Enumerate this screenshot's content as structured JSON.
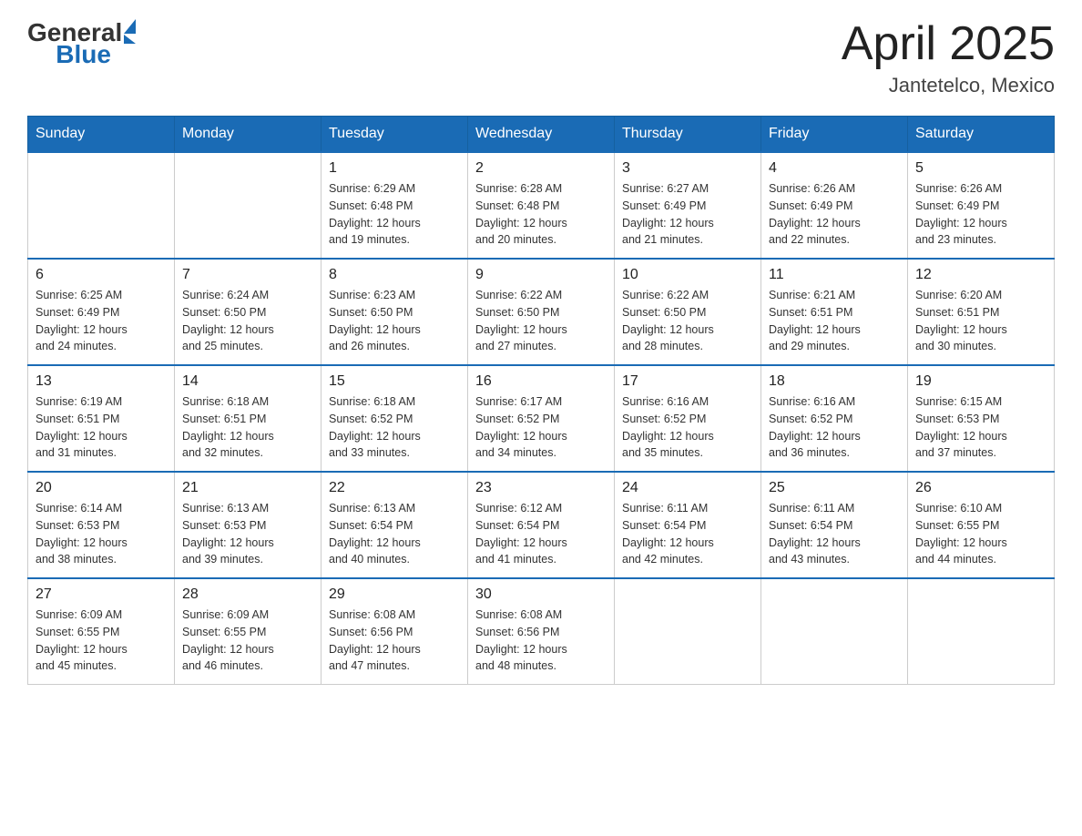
{
  "logo": {
    "general": "General",
    "blue": "Blue"
  },
  "title": {
    "month_year": "April 2025",
    "location": "Jantetelco, Mexico"
  },
  "header_days": [
    "Sunday",
    "Monday",
    "Tuesday",
    "Wednesday",
    "Thursday",
    "Friday",
    "Saturday"
  ],
  "weeks": [
    {
      "days": [
        {
          "num": "",
          "info": []
        },
        {
          "num": "",
          "info": []
        },
        {
          "num": "1",
          "info": [
            "Sunrise: 6:29 AM",
            "Sunset: 6:48 PM",
            "Daylight: 12 hours",
            "and 19 minutes."
          ]
        },
        {
          "num": "2",
          "info": [
            "Sunrise: 6:28 AM",
            "Sunset: 6:48 PM",
            "Daylight: 12 hours",
            "and 20 minutes."
          ]
        },
        {
          "num": "3",
          "info": [
            "Sunrise: 6:27 AM",
            "Sunset: 6:49 PM",
            "Daylight: 12 hours",
            "and 21 minutes."
          ]
        },
        {
          "num": "4",
          "info": [
            "Sunrise: 6:26 AM",
            "Sunset: 6:49 PM",
            "Daylight: 12 hours",
            "and 22 minutes."
          ]
        },
        {
          "num": "5",
          "info": [
            "Sunrise: 6:26 AM",
            "Sunset: 6:49 PM",
            "Daylight: 12 hours",
            "and 23 minutes."
          ]
        }
      ]
    },
    {
      "days": [
        {
          "num": "6",
          "info": [
            "Sunrise: 6:25 AM",
            "Sunset: 6:49 PM",
            "Daylight: 12 hours",
            "and 24 minutes."
          ]
        },
        {
          "num": "7",
          "info": [
            "Sunrise: 6:24 AM",
            "Sunset: 6:50 PM",
            "Daylight: 12 hours",
            "and 25 minutes."
          ]
        },
        {
          "num": "8",
          "info": [
            "Sunrise: 6:23 AM",
            "Sunset: 6:50 PM",
            "Daylight: 12 hours",
            "and 26 minutes."
          ]
        },
        {
          "num": "9",
          "info": [
            "Sunrise: 6:22 AM",
            "Sunset: 6:50 PM",
            "Daylight: 12 hours",
            "and 27 minutes."
          ]
        },
        {
          "num": "10",
          "info": [
            "Sunrise: 6:22 AM",
            "Sunset: 6:50 PM",
            "Daylight: 12 hours",
            "and 28 minutes."
          ]
        },
        {
          "num": "11",
          "info": [
            "Sunrise: 6:21 AM",
            "Sunset: 6:51 PM",
            "Daylight: 12 hours",
            "and 29 minutes."
          ]
        },
        {
          "num": "12",
          "info": [
            "Sunrise: 6:20 AM",
            "Sunset: 6:51 PM",
            "Daylight: 12 hours",
            "and 30 minutes."
          ]
        }
      ]
    },
    {
      "days": [
        {
          "num": "13",
          "info": [
            "Sunrise: 6:19 AM",
            "Sunset: 6:51 PM",
            "Daylight: 12 hours",
            "and 31 minutes."
          ]
        },
        {
          "num": "14",
          "info": [
            "Sunrise: 6:18 AM",
            "Sunset: 6:51 PM",
            "Daylight: 12 hours",
            "and 32 minutes."
          ]
        },
        {
          "num": "15",
          "info": [
            "Sunrise: 6:18 AM",
            "Sunset: 6:52 PM",
            "Daylight: 12 hours",
            "and 33 minutes."
          ]
        },
        {
          "num": "16",
          "info": [
            "Sunrise: 6:17 AM",
            "Sunset: 6:52 PM",
            "Daylight: 12 hours",
            "and 34 minutes."
          ]
        },
        {
          "num": "17",
          "info": [
            "Sunrise: 6:16 AM",
            "Sunset: 6:52 PM",
            "Daylight: 12 hours",
            "and 35 minutes."
          ]
        },
        {
          "num": "18",
          "info": [
            "Sunrise: 6:16 AM",
            "Sunset: 6:52 PM",
            "Daylight: 12 hours",
            "and 36 minutes."
          ]
        },
        {
          "num": "19",
          "info": [
            "Sunrise: 6:15 AM",
            "Sunset: 6:53 PM",
            "Daylight: 12 hours",
            "and 37 minutes."
          ]
        }
      ]
    },
    {
      "days": [
        {
          "num": "20",
          "info": [
            "Sunrise: 6:14 AM",
            "Sunset: 6:53 PM",
            "Daylight: 12 hours",
            "and 38 minutes."
          ]
        },
        {
          "num": "21",
          "info": [
            "Sunrise: 6:13 AM",
            "Sunset: 6:53 PM",
            "Daylight: 12 hours",
            "and 39 minutes."
          ]
        },
        {
          "num": "22",
          "info": [
            "Sunrise: 6:13 AM",
            "Sunset: 6:54 PM",
            "Daylight: 12 hours",
            "and 40 minutes."
          ]
        },
        {
          "num": "23",
          "info": [
            "Sunrise: 6:12 AM",
            "Sunset: 6:54 PM",
            "Daylight: 12 hours",
            "and 41 minutes."
          ]
        },
        {
          "num": "24",
          "info": [
            "Sunrise: 6:11 AM",
            "Sunset: 6:54 PM",
            "Daylight: 12 hours",
            "and 42 minutes."
          ]
        },
        {
          "num": "25",
          "info": [
            "Sunrise: 6:11 AM",
            "Sunset: 6:54 PM",
            "Daylight: 12 hours",
            "and 43 minutes."
          ]
        },
        {
          "num": "26",
          "info": [
            "Sunrise: 6:10 AM",
            "Sunset: 6:55 PM",
            "Daylight: 12 hours",
            "and 44 minutes."
          ]
        }
      ]
    },
    {
      "days": [
        {
          "num": "27",
          "info": [
            "Sunrise: 6:09 AM",
            "Sunset: 6:55 PM",
            "Daylight: 12 hours",
            "and 45 minutes."
          ]
        },
        {
          "num": "28",
          "info": [
            "Sunrise: 6:09 AM",
            "Sunset: 6:55 PM",
            "Daylight: 12 hours",
            "and 46 minutes."
          ]
        },
        {
          "num": "29",
          "info": [
            "Sunrise: 6:08 AM",
            "Sunset: 6:56 PM",
            "Daylight: 12 hours",
            "and 47 minutes."
          ]
        },
        {
          "num": "30",
          "info": [
            "Sunrise: 6:08 AM",
            "Sunset: 6:56 PM",
            "Daylight: 12 hours",
            "and 48 minutes."
          ]
        },
        {
          "num": "",
          "info": []
        },
        {
          "num": "",
          "info": []
        },
        {
          "num": "",
          "info": []
        }
      ]
    }
  ]
}
